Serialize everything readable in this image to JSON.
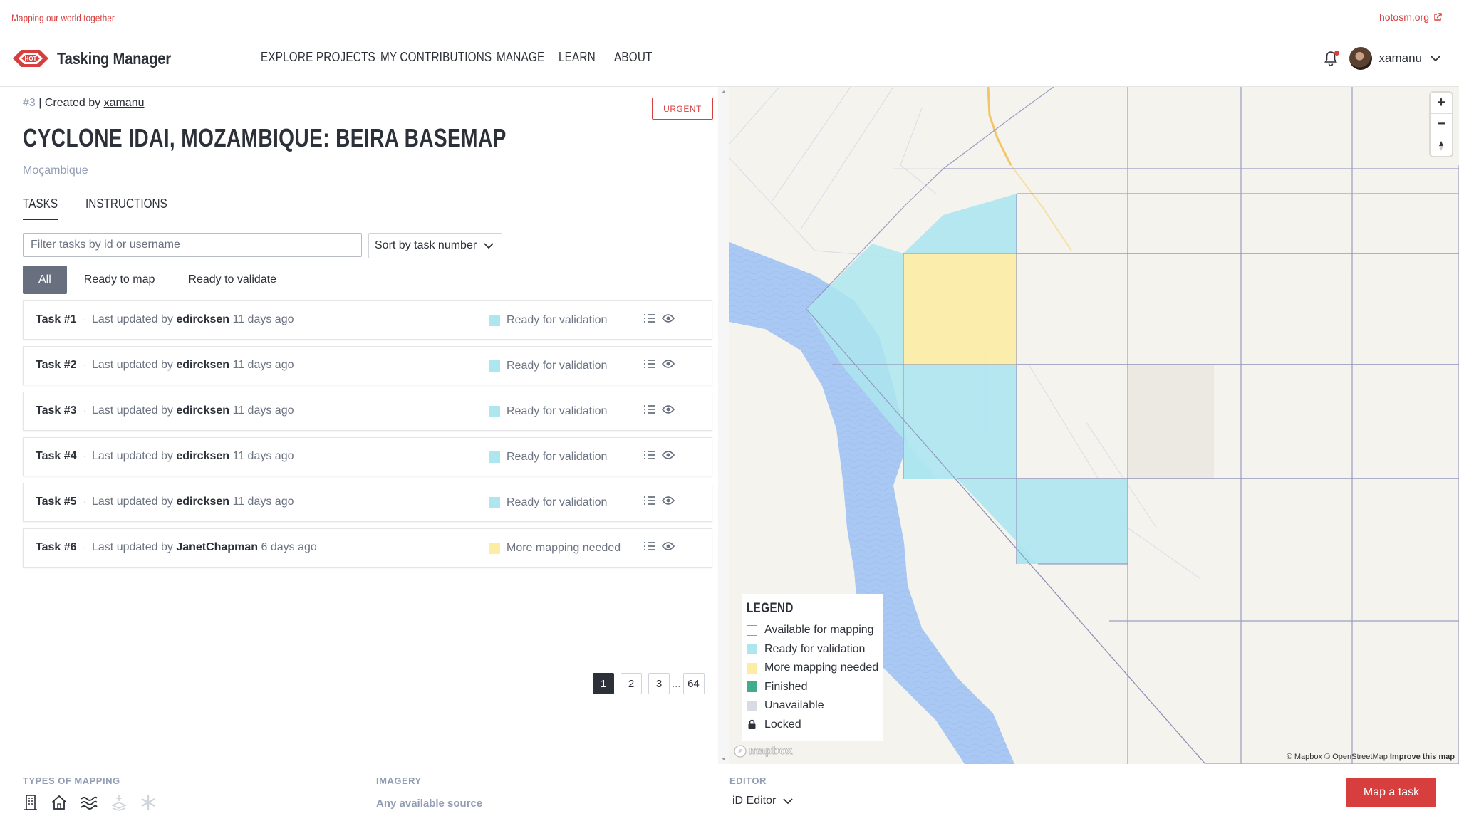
{
  "topbar": {
    "tagline": "Mapping our world together",
    "hot_link": "hotosm.org"
  },
  "navbar": {
    "logo_text": "Tasking Manager",
    "logo_badge": "HOT",
    "menu": [
      "EXPLORE PROJECTS",
      "MY CONTRIBUTIONS",
      "MANAGE",
      "LEARN",
      "ABOUT"
    ],
    "username": "xamanu"
  },
  "project": {
    "id": "#3",
    "created_by_label": "| Created by",
    "creator": "xamanu",
    "priority": "URGENT",
    "title": "CYCLONE IDAI, MOZAMBIQUE: BEIRA BASEMAP",
    "location": "Moçambique"
  },
  "tabs": [
    "TASKS",
    "INSTRUCTIONS"
  ],
  "filter": {
    "placeholder": "Filter tasks by id or username",
    "sort_label": "Sort by task number"
  },
  "status_filters": [
    "All",
    "Ready to map",
    "Ready to validate"
  ],
  "tasks": [
    {
      "name": "Task #1",
      "updated_prefix": "Last updated by",
      "user": "edircksen",
      "when": "11 days ago",
      "status": "Ready for validation",
      "color": "#ade6ef"
    },
    {
      "name": "Task #2",
      "updated_prefix": "Last updated by",
      "user": "edircksen",
      "when": "11 days ago",
      "status": "Ready for validation",
      "color": "#ade6ef"
    },
    {
      "name": "Task #3",
      "updated_prefix": "Last updated by",
      "user": "edircksen",
      "when": "11 days ago",
      "status": "Ready for validation",
      "color": "#ade6ef"
    },
    {
      "name": "Task #4",
      "updated_prefix": "Last updated by",
      "user": "edircksen",
      "when": "11 days ago",
      "status": "Ready for validation",
      "color": "#ade6ef"
    },
    {
      "name": "Task #5",
      "updated_prefix": "Last updated by",
      "user": "edircksen",
      "when": "11 days ago",
      "status": "Ready for validation",
      "color": "#ade6ef"
    },
    {
      "name": "Task #6",
      "updated_prefix": "Last updated by",
      "user": "JanetChapman",
      "when": "6 days ago",
      "status": "More mapping needed",
      "color": "#fceca4"
    }
  ],
  "pagination": {
    "pages": [
      "1",
      "2",
      "3"
    ],
    "ellipsis": "...",
    "last": "64",
    "current": "1"
  },
  "legend": {
    "title": "LEGEND",
    "items": [
      {
        "label": "Available for mapping",
        "color": "#ffffff"
      },
      {
        "label": "Ready for validation",
        "color": "#ade6ef"
      },
      {
        "label": "More mapping needed",
        "color": "#fceca4"
      },
      {
        "label": "Finished",
        "color": "#40ac8c"
      },
      {
        "label": "Unavailable",
        "color": "#d8dae4"
      },
      {
        "label": "Locked",
        "icon": "lock-icon"
      }
    ]
  },
  "map": {
    "mapbox_logo": "mapbox",
    "attribution": "© Mapbox © OpenStreetMap",
    "improve": "Improve this map",
    "zoom_in": "+",
    "zoom_out": "−"
  },
  "footer": {
    "types_label": "TYPES OF MAPPING",
    "type_icons": [
      "buildings-icon",
      "house-icon",
      "waterways-icon",
      "land-use-icon",
      "other-icon"
    ],
    "imagery_label": "IMAGERY",
    "imagery_value": "Any available source",
    "editor_label": "EDITOR",
    "editor_value": "iD Editor",
    "map_button": "Map a task"
  },
  "colors": {
    "accent": "#d73f3f",
    "dark": "#2c3038",
    "muted": "#929db3",
    "water": "#a9c8f3"
  }
}
